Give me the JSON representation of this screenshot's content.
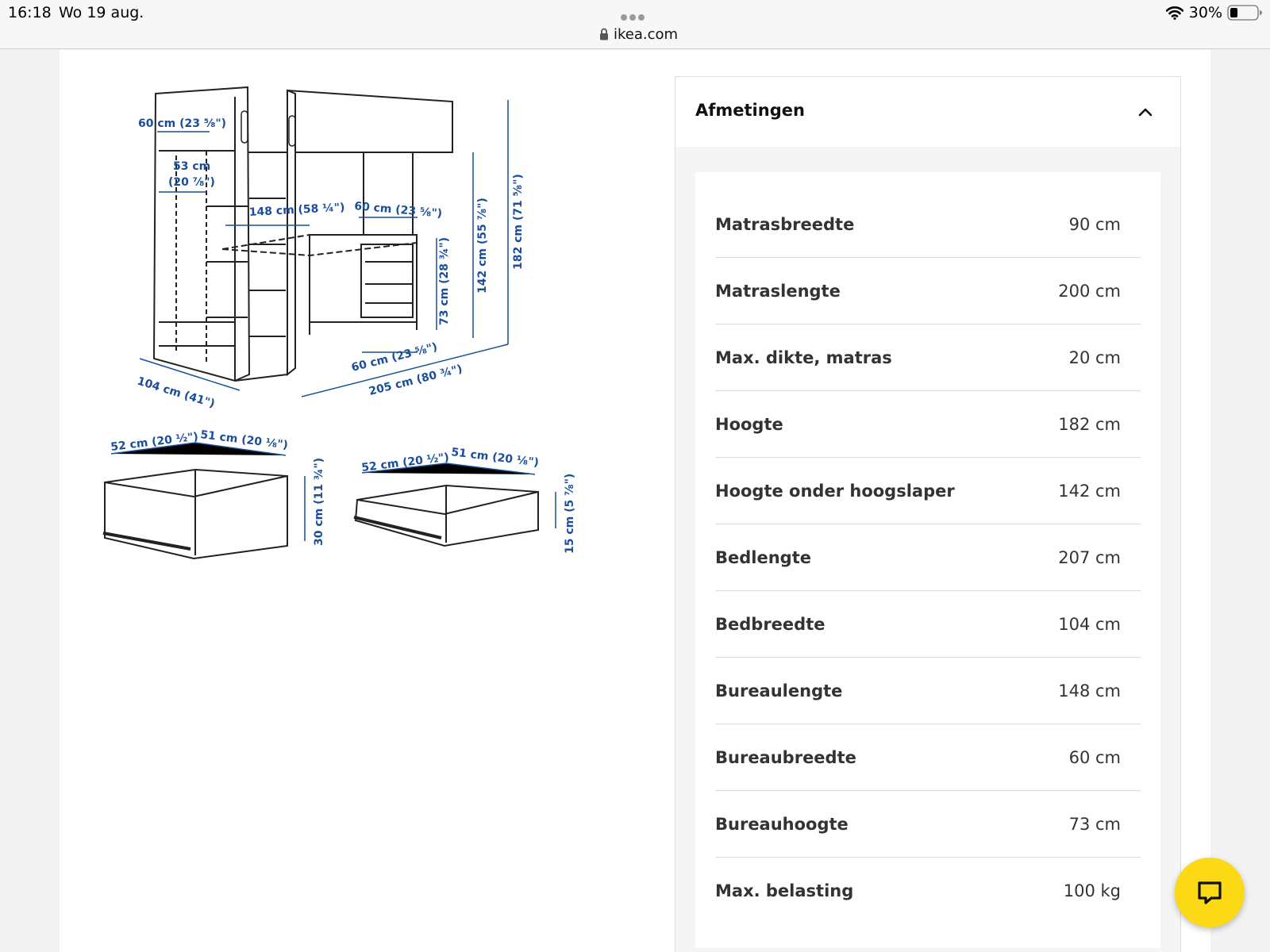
{
  "status_bar": {
    "time": "16:18",
    "date": "Wo 19 aug.",
    "url": "ikea.com",
    "battery": "30%"
  },
  "diagram": {
    "labels": {
      "top_depth": "60 cm (23 ⅝\")",
      "inner_width_1": "53 cm",
      "inner_width_2": "(20 ⅞\")",
      "desk_length": "148 cm (58 ¼\")",
      "desk_width_top": "60 cm (23 ⅝\")",
      "desk_height": "73 cm (28 ¾\")",
      "under_height": "142 cm (55 ⅞\")",
      "total_height": "182 cm (71 ⅝\")",
      "bed_width": "104 cm (41\")",
      "desk_width_bottom": "60 cm (23 ⅝\")",
      "bed_length": "205 cm (80 ¾\")",
      "drawer1_width": "52 cm (20 ½\")",
      "drawer1_depth": "51 cm (20 ⅛\")",
      "drawer1_height": "30 cm (11 ¾\")",
      "drawer2_width": "52 cm (20 ½\")",
      "drawer2_depth": "51 cm (20 ⅛\")",
      "drawer2_height": "15 cm (5 ⅞\")"
    }
  },
  "panel": {
    "title": "Afmetingen",
    "rows": [
      {
        "label": "Matrasbreedte",
        "value": "90 cm"
      },
      {
        "label": "Matraslengte",
        "value": "200 cm"
      },
      {
        "label": "Max. dikte, matras",
        "value": "20 cm"
      },
      {
        "label": "Hoogte",
        "value": "182 cm"
      },
      {
        "label": "Hoogte onder hoogslaper",
        "value": "142 cm"
      },
      {
        "label": "Bedlengte",
        "value": "207 cm"
      },
      {
        "label": "Bedbreedte",
        "value": "104 cm"
      },
      {
        "label": "Bureaulengte",
        "value": "148 cm"
      },
      {
        "label": "Bureaubreedte",
        "value": "60 cm"
      },
      {
        "label": "Bureauhoogte",
        "value": "73 cm"
      },
      {
        "label": "Max. belasting",
        "value": "100 kg"
      }
    ]
  },
  "colors": {
    "accent_dimension": "#1a4e9c",
    "chat_button": "#fbd914"
  },
  "icons": [
    "lock-icon",
    "wifi-icon",
    "battery-icon",
    "chevron-up-icon",
    "chat-icon"
  ]
}
